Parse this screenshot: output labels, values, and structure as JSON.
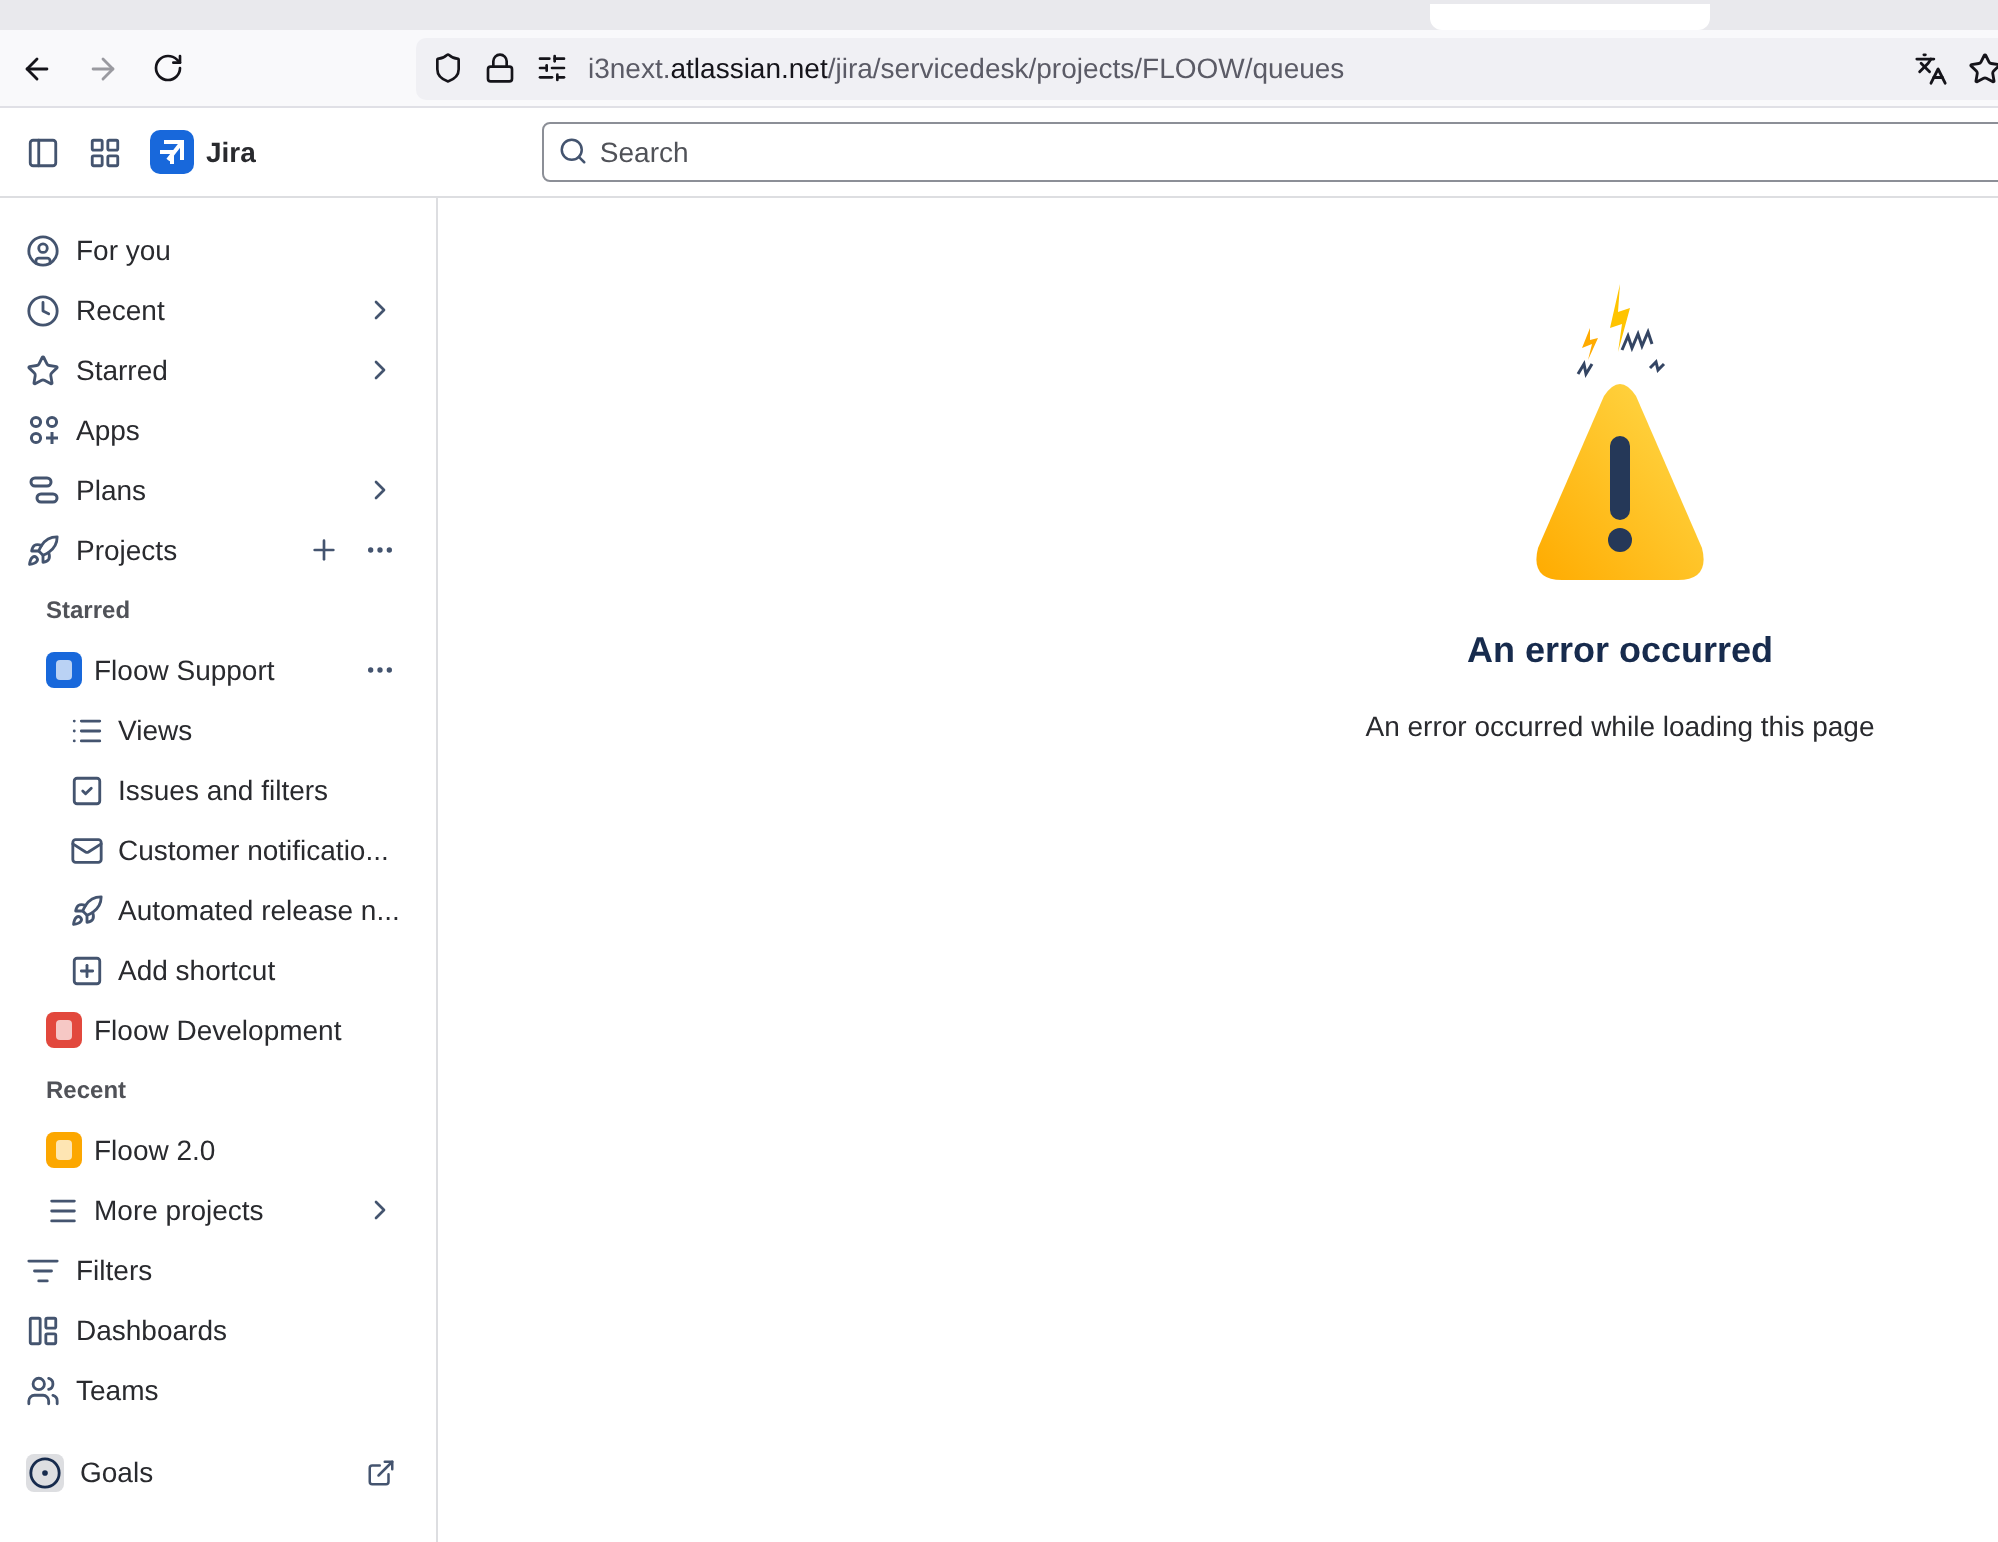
{
  "browser": {
    "url": "i3next.**atlassian.net**/jira/servicedesk/projects/FLOOW/queues"
  },
  "header": {
    "app_name": "Jira",
    "search": {
      "placeholder": "Search"
    }
  },
  "sidebar": {
    "items": [
      {
        "kind": "nav",
        "label": "For you"
      },
      {
        "kind": "nav",
        "label": "Recent",
        "chevron": true
      },
      {
        "kind": "nav",
        "label": "Starred",
        "chevron": true
      },
      {
        "kind": "nav",
        "label": "Apps"
      },
      {
        "kind": "nav",
        "label": "Plans",
        "chevron": true
      },
      {
        "kind": "nav",
        "label": "Projects",
        "add": true,
        "more": true
      },
      {
        "kind": "section",
        "label": "Starred"
      },
      {
        "kind": "project",
        "label": "Floow Support",
        "color": "#1868db",
        "more": true
      },
      {
        "kind": "sub",
        "label": "Views"
      },
      {
        "kind": "sub",
        "label": "Issues and filters"
      },
      {
        "kind": "sub",
        "label": "Customer notificatio..."
      },
      {
        "kind": "sub",
        "label": "Automated release n..."
      },
      {
        "kind": "sub",
        "label": "Add shortcut"
      },
      {
        "kind": "project",
        "label": "Floow Development",
        "color": "#e2483d"
      },
      {
        "kind": "section",
        "label": "Recent"
      },
      {
        "kind": "project",
        "label": "Floow 2.0",
        "color": "#fca700"
      },
      {
        "kind": "more",
        "label": "More projects",
        "chevron": true
      },
      {
        "kind": "nav",
        "label": "Filters"
      },
      {
        "kind": "nav",
        "label": "Dashboards"
      },
      {
        "kind": "nav",
        "label": "Teams"
      },
      {
        "kind": "gap"
      },
      {
        "kind": "nav",
        "label": "Goals",
        "external": true,
        "boxed": true
      }
    ]
  },
  "error": {
    "title": "An error occurred",
    "message": "An error occurred while loading this page"
  }
}
